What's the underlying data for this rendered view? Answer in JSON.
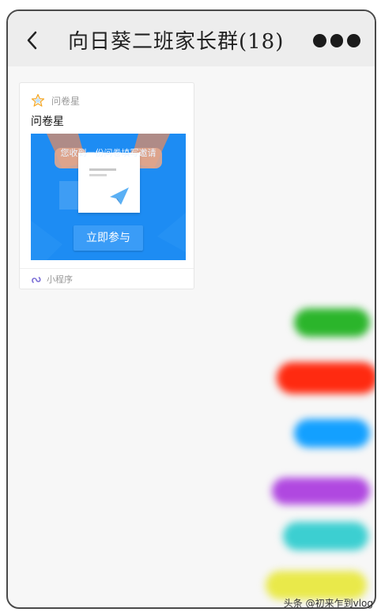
{
  "header": {
    "title": "向日葵二班家长群(18)",
    "back_icon": "chevron-left-icon",
    "more_icon": "more-dots-icon"
  },
  "message_card": {
    "source_name": "问卷星",
    "title": "问卷星",
    "image_caption": "您收到一份问卷填写邀请",
    "button_label": "立即参与",
    "footer_label": "小程序",
    "colors": {
      "image_background": "#1d8cf3",
      "button_background": "#3a9cf7",
      "star_icon": "#f5a623"
    }
  },
  "color_swatches": [
    "#2bb52b",
    "#ff2a10",
    "#13a0ff",
    "#b048e0",
    "#3ccfd1",
    "#e9e94a"
  ],
  "watermark": "头条 @初来乍到vlog"
}
